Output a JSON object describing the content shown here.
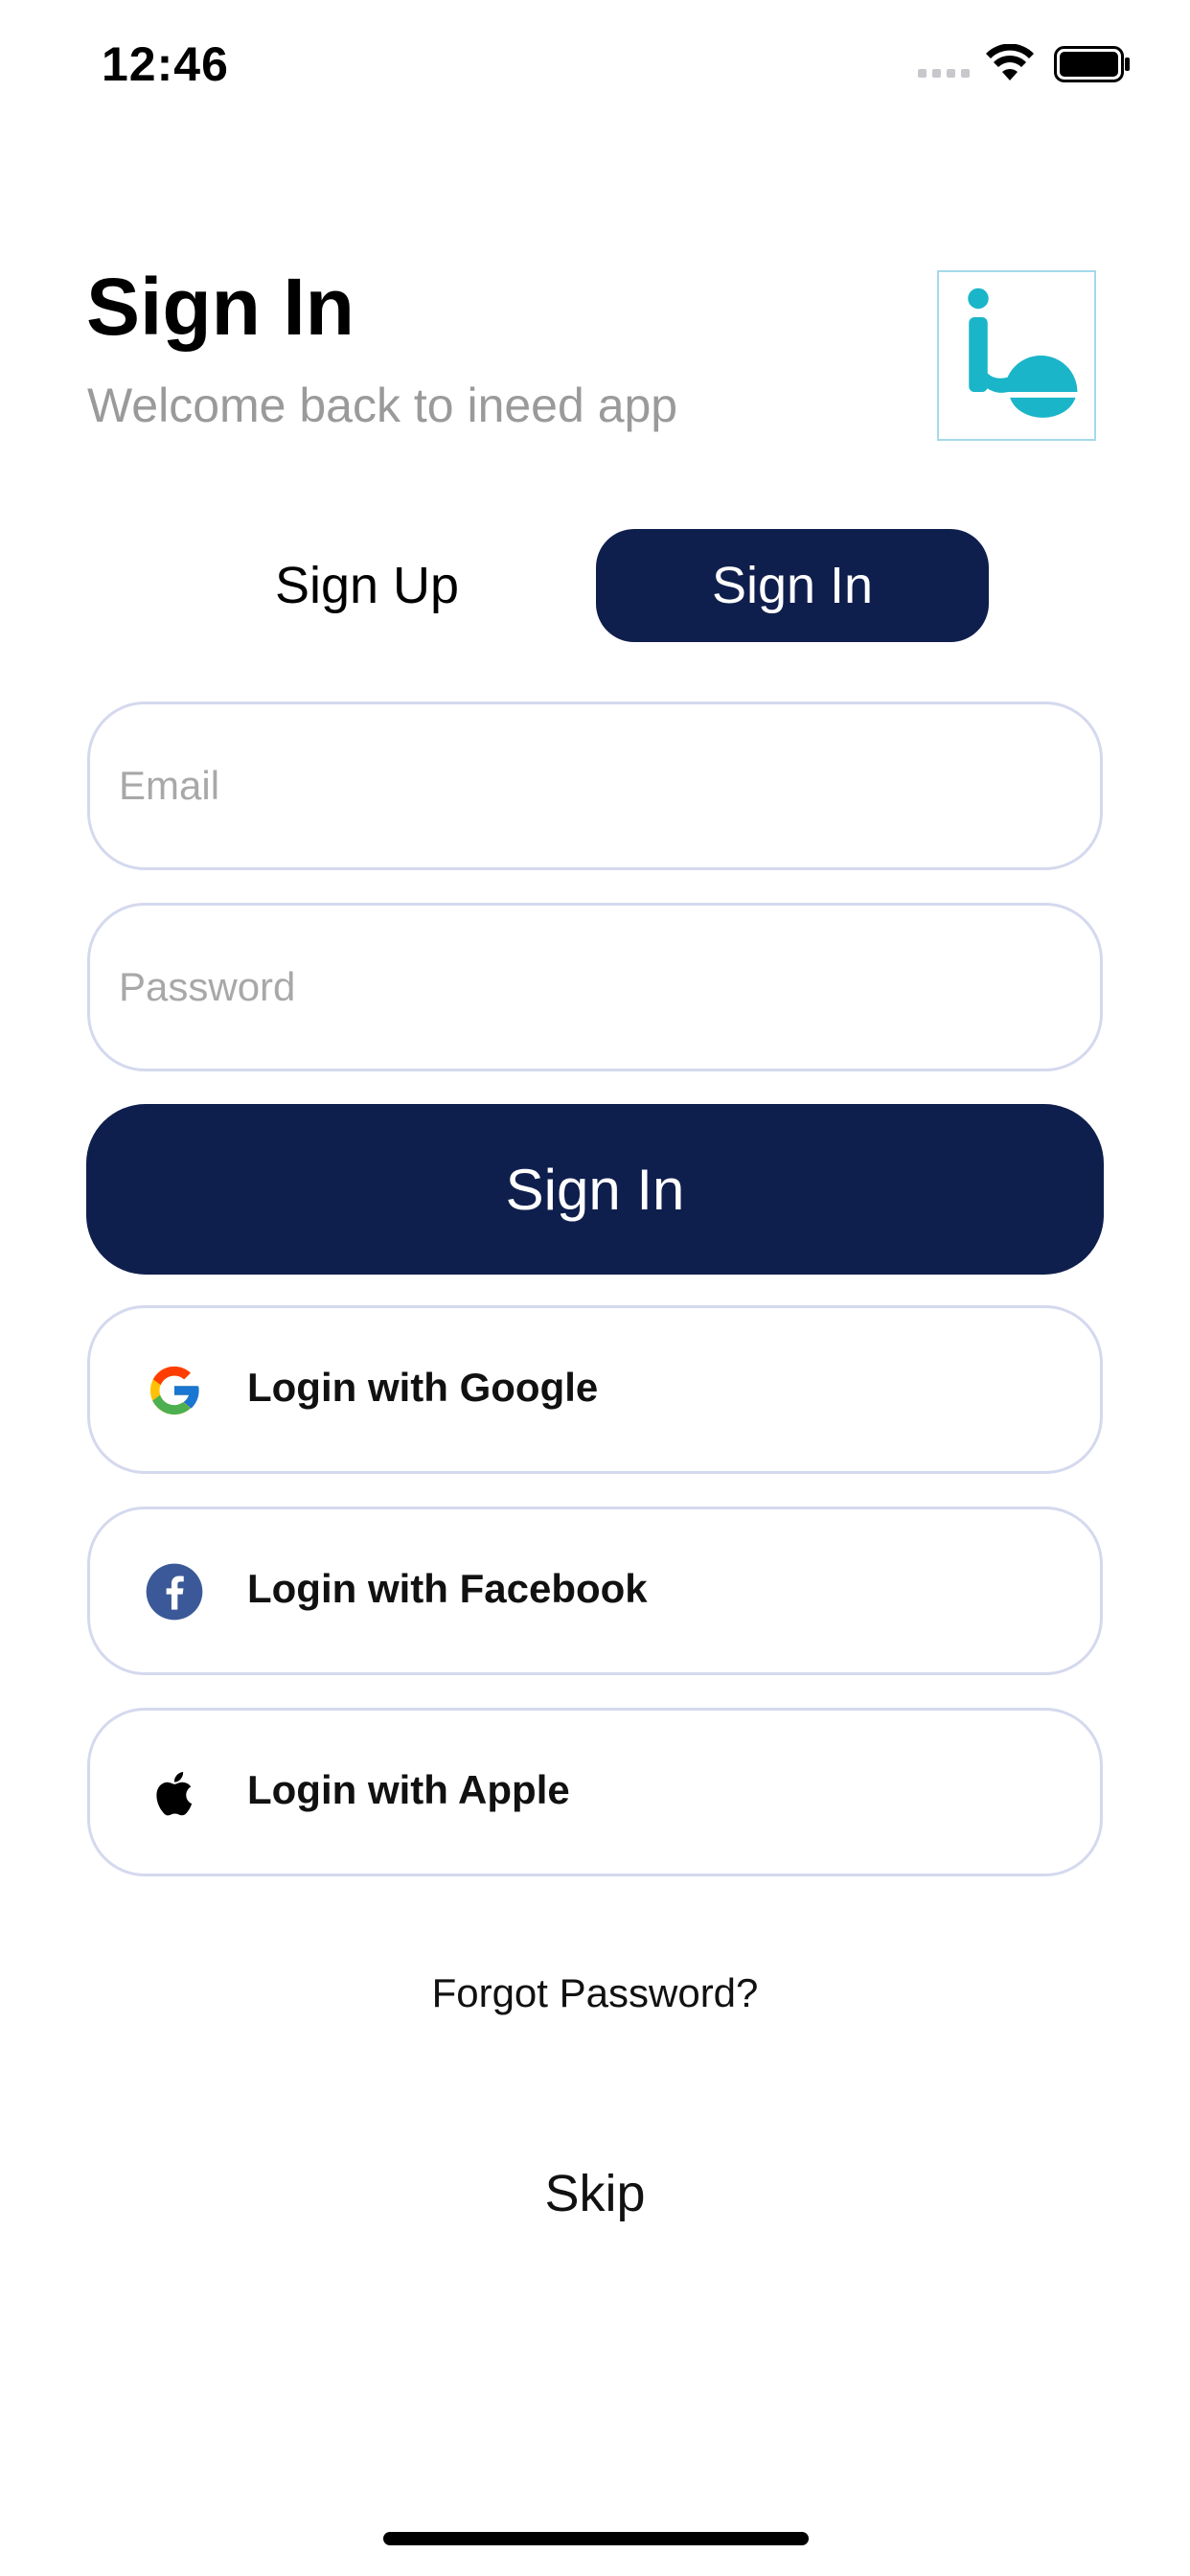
{
  "status_bar": {
    "time": "12:46"
  },
  "header": {
    "title": "Sign In",
    "subtitle": "Welcome back to ineed app",
    "logo_color": "#1bb5c9"
  },
  "tabs": [
    {
      "label": "Sign Up",
      "active": false
    },
    {
      "label": "Sign In",
      "active": true
    }
  ],
  "form": {
    "email": {
      "value": "",
      "placeholder": "Email"
    },
    "password": {
      "value": "",
      "placeholder": "Password"
    },
    "submit_label": "Sign In"
  },
  "social": [
    {
      "label": "Login with Google",
      "icon": "google-icon"
    },
    {
      "label": "Login with Facebook",
      "icon": "facebook-icon"
    },
    {
      "label": "Login with Apple",
      "icon": "apple-icon"
    }
  ],
  "links": {
    "forgot_password": "Forgot Password?",
    "skip": "Skip"
  },
  "colors": {
    "primary": "#0f1f4d",
    "border": "#d5d9ee",
    "subtitle": "#9a9a9a",
    "facebook": "#3b5998"
  }
}
